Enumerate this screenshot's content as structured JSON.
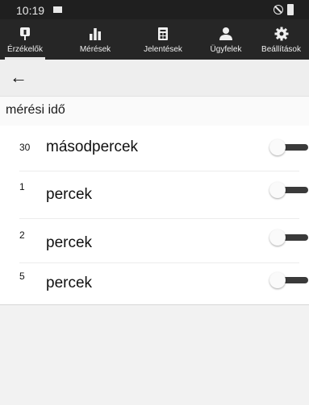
{
  "status_bar": {
    "time": "10:19",
    "icons": [
      "image-icon",
      "do-not-disturb-icon",
      "battery-icon"
    ]
  },
  "nav": {
    "tabs": [
      {
        "label": "Érzékelők",
        "icon": "sensor-icon",
        "active": true
      },
      {
        "label": "Mérések",
        "icon": "bar-chart-icon",
        "active": false
      },
      {
        "label": "Jelentések",
        "icon": "report-icon",
        "active": false
      },
      {
        "label": "Ügyfelek",
        "icon": "clients-icon",
        "active": false
      },
      {
        "label": "Beállítások",
        "icon": "gear-icon",
        "active": false
      }
    ]
  },
  "back": {
    "icon": "back-arrow-icon",
    "label": "←"
  },
  "section_title": "mérési idő",
  "options": [
    {
      "number": "30",
      "unit": "másodpercek",
      "enabled": false
    },
    {
      "number": "1",
      "unit": "percek",
      "enabled": false
    },
    {
      "number": "2",
      "unit": "percek",
      "enabled": false
    },
    {
      "number": "5",
      "unit": "percek",
      "enabled": false
    }
  ],
  "colors": {
    "nav_background": "#262626",
    "status_background": "#1f1f1f",
    "switch_track_off": "#3a3a3a",
    "switch_thumb": "#fafafa"
  }
}
